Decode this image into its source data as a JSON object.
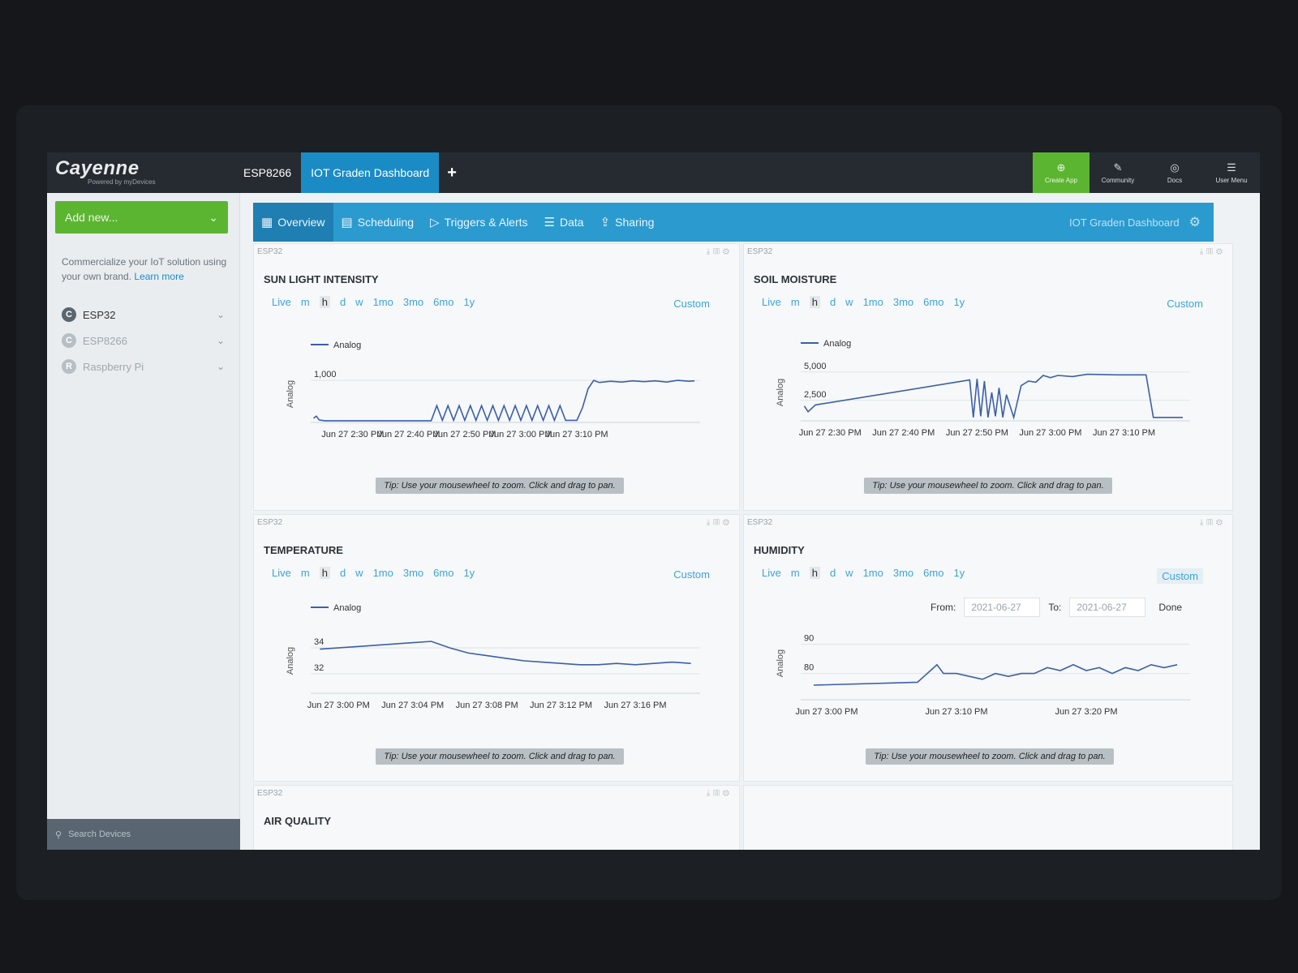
{
  "app": {
    "name": "Cayenne",
    "powered_by": "Powered by myDevices"
  },
  "tabs": {
    "device": "ESP8266",
    "dashboard": "IOT Graden Dashboard",
    "add": "+"
  },
  "topright": [
    {
      "label": "Create App",
      "icon": "create-app-icon"
    },
    {
      "label": "Community",
      "icon": "community-icon"
    },
    {
      "label": "Docs",
      "icon": "docs-icon"
    },
    {
      "label": "User Menu",
      "icon": "user-menu-icon"
    }
  ],
  "sidebar": {
    "add_new": "Add new...",
    "promo_text": "Commercialize your IoT solution using your own brand.",
    "promo_link": "Learn more",
    "devices": [
      {
        "name": "ESP32",
        "icon": "C"
      },
      {
        "name": "ESP8266",
        "icon": "C"
      },
      {
        "name": "Raspberry Pi",
        "icon": "R"
      }
    ],
    "search_placeholder": "Search Devices"
  },
  "nav": {
    "items": [
      "Overview",
      "Scheduling",
      "Triggers & Alerts",
      "Data",
      "Sharing"
    ],
    "title": "IOT Graden Dashboard"
  },
  "range_options": [
    "Live",
    "m",
    "h",
    "d",
    "w",
    "1mo",
    "3mo",
    "6mo",
    "1y"
  ],
  "widgets": {
    "sun": {
      "device": "ESP32",
      "title": "SUN LIGHT INTENSITY",
      "custom": "Custom",
      "tip": "Tip: Use your mousewheel to zoom. Click and drag to pan."
    },
    "soil": {
      "device": "ESP32",
      "title": "SOIL MOISTURE",
      "custom": "Custom",
      "tip": "Tip: Use your mousewheel to zoom. Click and drag to pan."
    },
    "temp": {
      "device": "ESP32",
      "title": "TEMPERATURE",
      "custom": "Custom",
      "tip": "Tip: Use your mousewheel to zoom. Click and drag to pan."
    },
    "hum": {
      "device": "ESP32",
      "title": "HUMIDITY",
      "custom": "Custom",
      "tip": "Tip: Use your mousewheel to zoom. Click and drag to pan.",
      "from_label": "From:",
      "from_value": "2021-06-27",
      "to_label": "To:",
      "to_value": "2021-06-27",
      "done": "Done"
    },
    "air": {
      "device": "ESP32",
      "title": "AIR QUALITY"
    }
  },
  "chart_data": [
    {
      "type": "line",
      "title": "SUN LIGHT INTENSITY",
      "ylabel": "Analog",
      "legend": "Analog",
      "yticks": [
        1000
      ],
      "ytick_labels": [
        "1,000"
      ],
      "ylim": [
        0,
        1350
      ],
      "xlim": [
        2.5,
        72
      ],
      "xticks": [
        10,
        20,
        30,
        40,
        50
      ],
      "xtick_labels": [
        "Jun 27 2:30 PM",
        "Jun 27 2:40 PM",
        "Jun 27 2:50 PM",
        "Jun 27 3:00 PM",
        "Jun 27 3:10 PM"
      ],
      "series": [
        {
          "name": "Analog",
          "points": [
            [
              3,
              100
            ],
            [
              3.5,
              150
            ],
            [
              4,
              60
            ],
            [
              5,
              40
            ],
            [
              24,
              40
            ],
            [
              25,
              400
            ],
            [
              26,
              50
            ],
            [
              27,
              400
            ],
            [
              28,
              50
            ],
            [
              29,
              400
            ],
            [
              30,
              50
            ],
            [
              31,
              400
            ],
            [
              32,
              50
            ],
            [
              33,
              400
            ],
            [
              34,
              50
            ],
            [
              35,
              400
            ],
            [
              36,
              50
            ],
            [
              37,
              400
            ],
            [
              38,
              50
            ],
            [
              39,
              400
            ],
            [
              40,
              50
            ],
            [
              41,
              400
            ],
            [
              42,
              50
            ],
            [
              43,
              400
            ],
            [
              44,
              50
            ],
            [
              45,
              400
            ],
            [
              46,
              50
            ],
            [
              47,
              400
            ],
            [
              48,
              50
            ],
            [
              50,
              50
            ],
            [
              51,
              350
            ],
            [
              52,
              800
            ],
            [
              53,
              1000
            ],
            [
              54,
              950
            ],
            [
              56,
              980
            ],
            [
              58,
              960
            ],
            [
              60,
              990
            ],
            [
              62,
              970
            ],
            [
              64,
              990
            ],
            [
              66,
              960
            ],
            [
              68,
              1000
            ],
            [
              70,
              980
            ],
            [
              71,
              990
            ]
          ]
        }
      ]
    },
    {
      "type": "line",
      "title": "SOIL MOISTURE",
      "ylabel": "Analog",
      "legend": "Analog",
      "yticks": [
        2500,
        5000
      ],
      "ytick_labels": [
        "2,500",
        "5,000"
      ],
      "ylim": [
        700,
        5700
      ],
      "xlim": [
        1,
        54
      ],
      "xticks": [
        5,
        15,
        25,
        35,
        45
      ],
      "xtick_labels": [
        "Jun 27 2:30 PM",
        "Jun 27 2:40 PM",
        "Jun 27 2:50 PM",
        "Jun 27 3:00 PM",
        "Jun 27 3:10 PM"
      ],
      "series": [
        {
          "name": "Analog",
          "points": [
            [
              1.5,
              2000
            ],
            [
              2,
              1500
            ],
            [
              3,
              2100
            ],
            [
              24,
              4300
            ],
            [
              24.5,
              1000
            ],
            [
              25,
              4400
            ],
            [
              25.5,
              1100
            ],
            [
              26,
              4200
            ],
            [
              26.5,
              1000
            ],
            [
              27,
              3200
            ],
            [
              27.5,
              1100
            ],
            [
              28,
              3600
            ],
            [
              28.5,
              1000
            ],
            [
              29,
              3000
            ],
            [
              30,
              1000
            ],
            [
              31,
              3800
            ],
            [
              32,
              4200
            ],
            [
              33,
              4100
            ],
            [
              34,
              4700
            ],
            [
              35,
              4500
            ],
            [
              36,
              4700
            ],
            [
              38,
              4600
            ],
            [
              40,
              4800
            ],
            [
              44,
              4750
            ],
            [
              48,
              4750
            ],
            [
              49,
              1000
            ],
            [
              53,
              1000
            ]
          ]
        }
      ]
    },
    {
      "type": "line",
      "title": "TEMPERATURE",
      "ylabel": "Analog",
      "legend": "Analog",
      "yticks": [
        32,
        34
      ],
      "ytick_labels": [
        "32",
        "34"
      ],
      "ylim": [
        30.5,
        35.5
      ],
      "xlim": [
        -0.5,
        20.5
      ],
      "xticks": [
        1,
        5,
        9,
        13,
        17
      ],
      "xtick_labels": [
        "Jun 27 3:00 PM",
        "Jun 27 3:04 PM",
        "Jun 27 3:08 PM",
        "Jun 27 3:12 PM",
        "Jun 27 3:16 PM"
      ],
      "series": [
        {
          "name": "Analog",
          "points": [
            [
              0,
              33.9
            ],
            [
              2,
              34.1
            ],
            [
              4,
              34.3
            ],
            [
              6,
              34.5
            ],
            [
              7,
              34.0
            ],
            [
              8,
              33.6
            ],
            [
              9,
              33.4
            ],
            [
              10,
              33.2
            ],
            [
              11,
              33.0
            ],
            [
              12,
              32.9
            ],
            [
              13,
              32.8
            ],
            [
              14,
              32.7
            ],
            [
              15,
              32.7
            ],
            [
              16,
              32.8
            ],
            [
              17,
              32.7
            ],
            [
              18,
              32.8
            ],
            [
              19,
              32.9
            ],
            [
              20,
              32.8
            ]
          ]
        }
      ]
    },
    {
      "type": "line",
      "title": "HUMIDITY",
      "ylabel": "Analog",
      "yticks": [
        80,
        90
      ],
      "ytick_labels": [
        "80",
        "90"
      ],
      "ylim": [
        71,
        96
      ],
      "xlim": [
        -1,
        29
      ],
      "xticks": [
        1,
        11,
        21
      ],
      "xtick_labels": [
        "Jun 27 3:00 PM",
        "Jun 27 3:10 PM",
        "Jun 27 3:20 PM"
      ],
      "series": [
        {
          "name": "Analog",
          "points": [
            [
              0,
              76
            ],
            [
              8,
              77
            ],
            [
              8.5,
              79
            ],
            [
              9,
              81
            ],
            [
              9.5,
              83
            ],
            [
              10,
              80
            ],
            [
              11,
              80
            ],
            [
              12,
              79
            ],
            [
              13,
              78
            ],
            [
              14,
              80
            ],
            [
              15,
              79
            ],
            [
              16,
              80
            ],
            [
              17,
              80
            ],
            [
              18,
              82
            ],
            [
              19,
              81
            ],
            [
              20,
              83
            ],
            [
              21,
              81
            ],
            [
              22,
              82
            ],
            [
              23,
              80
            ],
            [
              24,
              82
            ],
            [
              25,
              81
            ],
            [
              26,
              83
            ],
            [
              27,
              82
            ],
            [
              28,
              83
            ]
          ]
        }
      ]
    }
  ]
}
